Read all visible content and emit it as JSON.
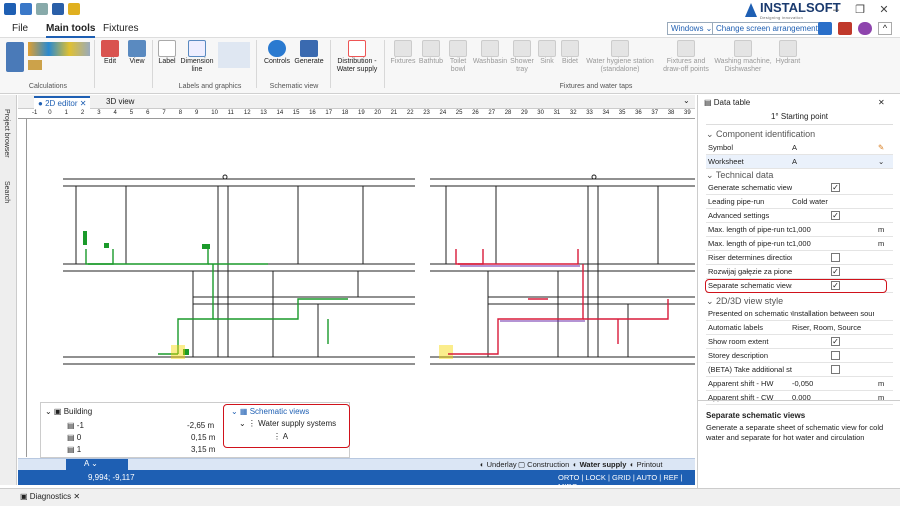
{
  "app": {
    "brand": "INSTALSOFT",
    "brand_tagline": "Designing innovation"
  },
  "menu": {
    "file": "File",
    "main_tools": "Main tools",
    "fixtures": "Fixtures"
  },
  "top_selects": {
    "windows": "Windows",
    "arrangement": "Change screen arrangement"
  },
  "ribbon": {
    "calc_label": "Calculations",
    "edit": "Edit",
    "view": "View",
    "label": "Label",
    "dimension": "Dimension line",
    "labels_group": "Labels and graphics",
    "controls": "Controls",
    "generate": "Generate",
    "schematic_group": "Schematic view",
    "distribution": "Distribution - Water supply",
    "fixtures": [
      "Fixtures",
      "Bathtub",
      "Toilet bowl",
      "Washbasin",
      "Shower tray",
      "Sink",
      "Bidet",
      "Water hygiene station (standalone)",
      "Fixtures and draw-off points",
      "Washing machine, Dishwasher",
      "Hydrant"
    ],
    "fixtures_group": "Fixtures and water taps"
  },
  "sidebar": {
    "project_browser": "Project browser",
    "search": "Search"
  },
  "tabs": {
    "editor2d": "2D editor",
    "view3d": "3D view"
  },
  "ruler_ticks": [
    "-1",
    "0",
    "1",
    "2",
    "3",
    "4",
    "5",
    "6",
    "7",
    "8",
    "9",
    "10",
    "11",
    "12",
    "13",
    "14",
    "15",
    "16",
    "17",
    "18",
    "19",
    "20",
    "21",
    "22",
    "23",
    "24",
    "25",
    "26",
    "27",
    "28",
    "29",
    "30",
    "31",
    "32",
    "33",
    "34",
    "35",
    "36",
    "37",
    "38",
    "39"
  ],
  "tree": {
    "building": "Building",
    "levels": [
      {
        "name": "-1",
        "value": "-2,65 m"
      },
      {
        "name": "0",
        "value": "0,15 m"
      },
      {
        "name": "1",
        "value": "3,15 m"
      }
    ],
    "schematic_views": "Schematic views",
    "water_supply": "Water supply systems",
    "item": "A"
  },
  "statusbar": {
    "layer": "A",
    "underlay": "Underlay",
    "construction": "Construction",
    "water_supply": "Water supply",
    "printout": "Printout"
  },
  "bluebar": {
    "coords": "9,994; -9,117",
    "modes": "ORTO | LOCK | GRID | AUTO | REF | MIRO"
  },
  "diagnostics": "Diagnostics",
  "panel": {
    "title": "Data table",
    "subtitle": "1° Starting point",
    "section_component": "Component identification",
    "symbol_label": "Symbol",
    "symbol_value": "A",
    "worksheet_label": "Worksheet",
    "worksheet_value": "A",
    "section_technical": "Technical data",
    "rows": [
      {
        "k": "Generate schematic view",
        "v": "",
        "cb": true
      },
      {
        "k": "Leading pipe-run",
        "v": "Cold water"
      },
      {
        "k": "Advanced settings",
        "v": "",
        "cb": true
      },
      {
        "k": "Max. length of pipe-run to",
        "v": "1,000",
        "u": "m"
      },
      {
        "k": "Max. length of pipe-run to",
        "v": "1,000",
        "u": "m"
      },
      {
        "k": "Riser determines direction",
        "v": "",
        "cb": false
      },
      {
        "k": "Rozwijaj gałęzie za pionem",
        "v": "",
        "cb": true
      },
      {
        "k": "Separate schematic views",
        "v": "",
        "cb": true
      }
    ],
    "section_view": "2D/3D view style",
    "rows2": [
      {
        "k": "Presented on schematic view",
        "v": "Installation between source"
      },
      {
        "k": "Automatic labels",
        "v": "Riser, Room, Source"
      },
      {
        "k": "Show room extent",
        "v": "",
        "cb": true
      },
      {
        "k": "Storey description",
        "v": "",
        "cb": false
      },
      {
        "k": "(BETA) Take additional storeys",
        "v": "",
        "cb": false
      },
      {
        "k": "Apparent shift - HW",
        "v": "-0,050",
        "u": "m"
      },
      {
        "k": "Apparent shift - CW",
        "v": "0,000",
        "u": "m"
      }
    ],
    "desc_title": "Separate schematic views",
    "desc_text": "Generate a separate sheet of schematic view for cold water and separate for hot water and circulation"
  }
}
